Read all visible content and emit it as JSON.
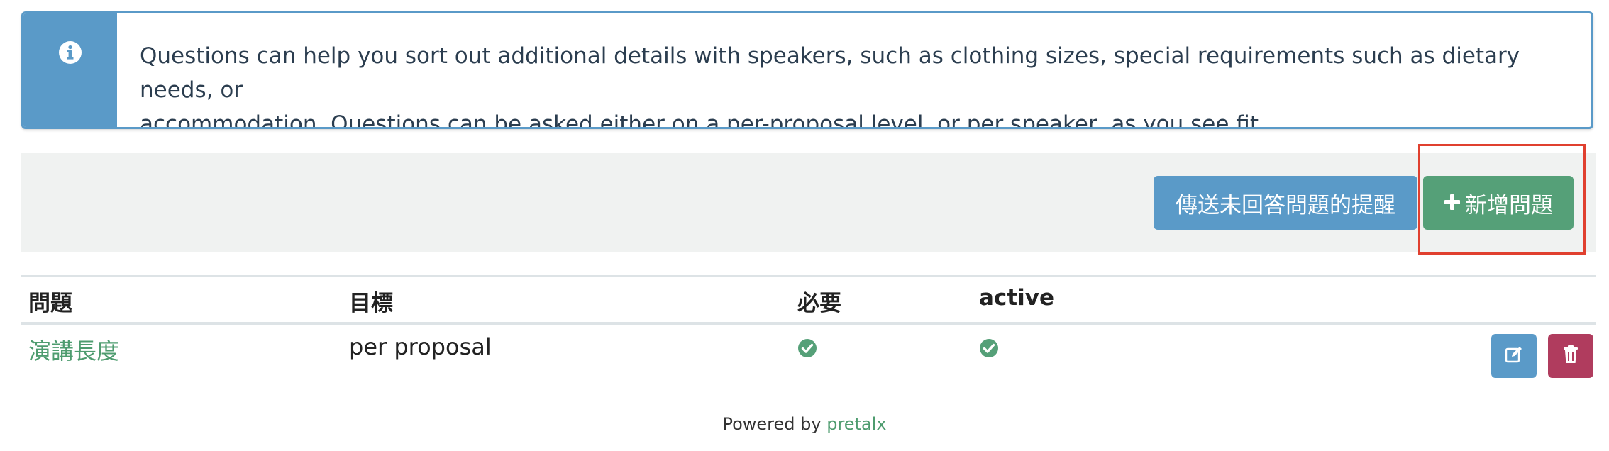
{
  "info_alert": {
    "icon": "info-circle-icon",
    "text_line1": "Questions can help you sort out additional details with speakers, such as clothing sizes, special requirements such as dietary needs, or",
    "text_line2": "accommodation. Questions can be asked either on a per-proposal level, or per speaker, as you see fit."
  },
  "actions": {
    "reminder_label": "傳送未回答問題的提醒",
    "add_label": "新增問題",
    "add_icon": "plus-icon"
  },
  "table": {
    "headers": [
      "問題",
      "目標",
      "必要",
      "active"
    ],
    "rows": [
      {
        "question": "演講長度",
        "target": "per proposal",
        "required": true,
        "active": true
      }
    ]
  },
  "footer": {
    "prefix": "Powered by",
    "brand": "pretalx"
  },
  "colors": {
    "info": "#5a9ac8",
    "success": "#55a078",
    "danger": "#b03c5e",
    "highlight": "#e0402f"
  }
}
